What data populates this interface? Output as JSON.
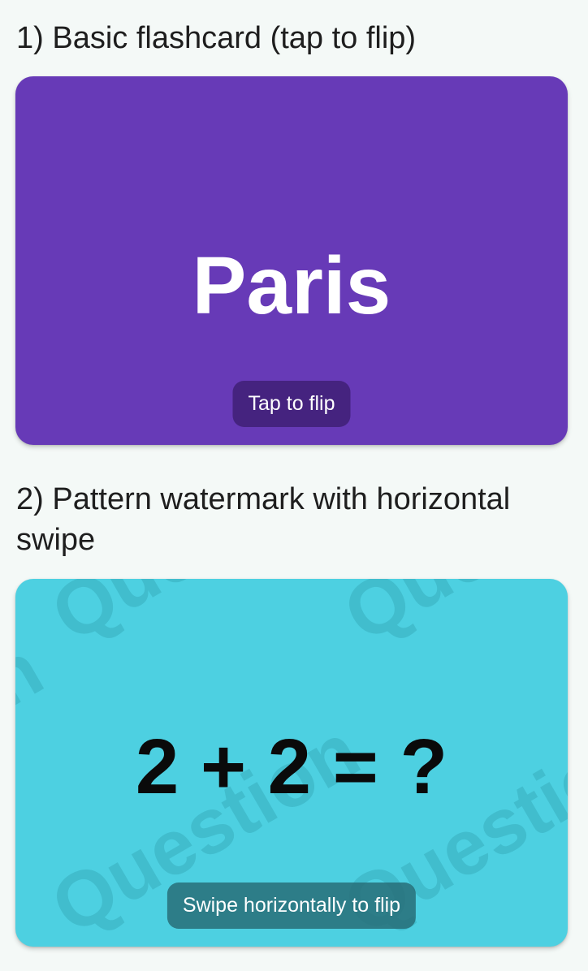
{
  "sections": [
    {
      "title": "1) Basic flashcard (tap to flip)",
      "card_text": "Paris",
      "hint": "Tap to flip",
      "card_color": "#673ab7"
    },
    {
      "title": "2) Pattern watermark with horizontal swipe",
      "card_text": "2 + 2 = ?",
      "hint": "Swipe horizontally to flip",
      "card_color": "#4dd0e1",
      "watermark_text": "Question"
    }
  ]
}
